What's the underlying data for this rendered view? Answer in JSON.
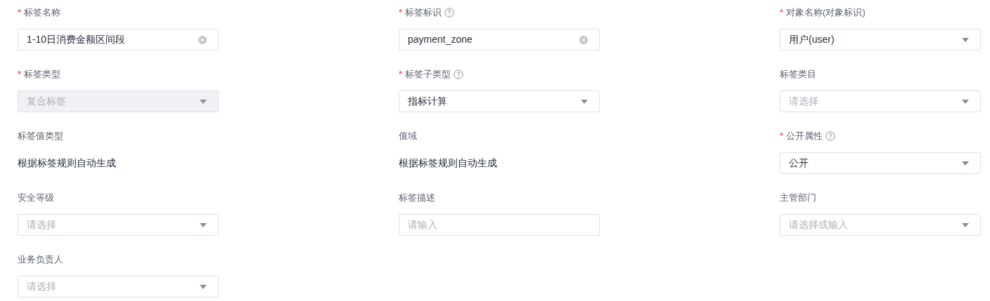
{
  "form": {
    "fields": [
      {
        "label": "标签名称",
        "required_mark": "*",
        "help": false,
        "kind": "input",
        "value": "1-10日消费金额区间段",
        "clearable": true,
        "disabled": false
      },
      {
        "label": "标签标识",
        "required_mark": "*",
        "help": true,
        "kind": "input",
        "value": "payment_zone",
        "clearable": true,
        "disabled": false
      },
      {
        "label": "对象名称(对象标识)",
        "required_mark": "*",
        "help": false,
        "kind": "select",
        "value": "用户(user)",
        "disabled": false
      },
      {
        "label": "标签类型",
        "required_mark": "*",
        "help": false,
        "kind": "select",
        "value": "复合标签",
        "disabled": true
      },
      {
        "label": "标签子类型",
        "required_mark": "*",
        "help": true,
        "kind": "select",
        "value": "指标计算",
        "disabled": false
      },
      {
        "label": "标签类目",
        "help": false,
        "kind": "select",
        "placeholder": "请选择",
        "disabled": false
      },
      {
        "label": "标签值类型",
        "help": false,
        "kind": "text",
        "value": "根据标签规则自动生成"
      },
      {
        "label": "值域",
        "help": false,
        "kind": "text",
        "value": "根据标签规则自动生成"
      },
      {
        "label": "公开属性",
        "required_mark": "*",
        "help": true,
        "kind": "select",
        "value": "公开",
        "disabled": false
      },
      {
        "label": "安全等级",
        "help": false,
        "kind": "select",
        "placeholder": "请选择",
        "disabled": false
      },
      {
        "label": "标签描述",
        "help": false,
        "kind": "input",
        "placeholder": "请输入",
        "disabled": false
      },
      {
        "label": "主管部门",
        "help": false,
        "kind": "select",
        "placeholder": "请选择或输入",
        "disabled": false
      },
      {
        "label": "业务负责人",
        "help": false,
        "kind": "select",
        "placeholder": "请选择",
        "disabled": false
      }
    ]
  }
}
